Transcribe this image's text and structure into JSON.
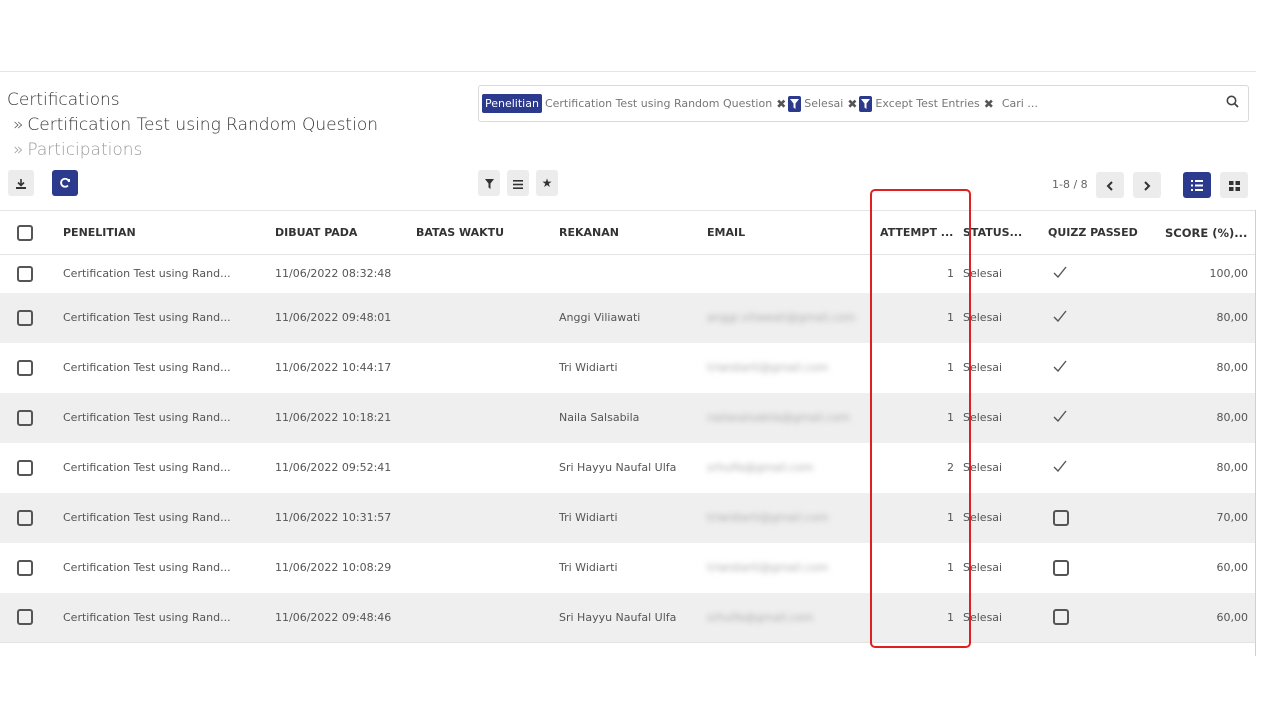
{
  "breadcrumb": {
    "item1": "Certifications",
    "sep": "»",
    "item2": "Certification Test using Random Question",
    "item3": "Participations"
  },
  "search": {
    "facet_tag": "Penelitian",
    "facet_value": "Certification Test using Random Question",
    "filter1": "Selesai",
    "filter2": "Except Test Entries",
    "placeholder": "Cari ...",
    "search_icon": "search-icon"
  },
  "toolbar": {
    "download_icon": "download-icon",
    "refresh_icon": "refresh-icon",
    "filter_icon": "filter-icon",
    "groupby_icon": "list-icon",
    "favorites_icon": "star-icon",
    "list_view_icon": "list-view-icon",
    "kanban_view_icon": "kanban-view-icon"
  },
  "pager": {
    "text": "1-8 / 8"
  },
  "colors": {
    "accent": "#2b3a8c",
    "highlight": "#e02020",
    "stripe": "#efefef"
  },
  "table": {
    "headers": {
      "penelitian": "PENELITIAN",
      "dibuat": "DIBUAT PADA",
      "batas": "BATAS WAKTU",
      "rekanan": "REKANAN",
      "email": "EMAIL",
      "attempt": "ATTEMPT ...",
      "status": "STATUS...",
      "passed": "QUIZZ PASSED",
      "score": "SCORE (%)..."
    },
    "rows": [
      {
        "penelitian": "Certification Test using Rand...",
        "dibuat": "11/06/2022 08:32:48",
        "batas": "",
        "rekanan": "",
        "email": "",
        "attempt": "1",
        "status": "Selesai",
        "passed": true,
        "score": "100,00"
      },
      {
        "penelitian": "Certification Test using Rand...",
        "dibuat": "11/06/2022 09:48:01",
        "batas": "",
        "rekanan": "Anggi Viliawati",
        "email": "anggi.viliawati@gmail.com",
        "attempt": "1",
        "status": "Selesai",
        "passed": true,
        "score": "80,00"
      },
      {
        "penelitian": "Certification Test using Rand...",
        "dibuat": "11/06/2022 10:44:17",
        "batas": "",
        "rekanan": "Tri Widiarti",
        "email": "triwidiarti@gmail.com",
        "attempt": "1",
        "status": "Selesai",
        "passed": true,
        "score": "80,00"
      },
      {
        "penelitian": "Certification Test using Rand...",
        "dibuat": "11/06/2022 10:18:21",
        "batas": "",
        "rekanan": "Naila Salsabila",
        "email": "nailasalsabila@gmail.com",
        "attempt": "1",
        "status": "Selesai",
        "passed": true,
        "score": "80,00"
      },
      {
        "penelitian": "Certification Test using Rand...",
        "dibuat": "11/06/2022 09:52:41",
        "batas": "",
        "rekanan": "Sri Hayyu Naufal Ulfa",
        "email": "srhulfa@gmail.com",
        "attempt": "2",
        "status": "Selesai",
        "passed": true,
        "score": "80,00"
      },
      {
        "penelitian": "Certification Test using Rand...",
        "dibuat": "11/06/2022 10:31:57",
        "batas": "",
        "rekanan": "Tri Widiarti",
        "email": "triwidiarti@gmail.com",
        "attempt": "1",
        "status": "Selesai",
        "passed": false,
        "score": "70,00"
      },
      {
        "penelitian": "Certification Test using Rand...",
        "dibuat": "11/06/2022 10:08:29",
        "batas": "",
        "rekanan": "Tri Widiarti",
        "email": "triwidiarti@gmail.com",
        "attempt": "1",
        "status": "Selesai",
        "passed": false,
        "score": "60,00"
      },
      {
        "penelitian": "Certification Test using Rand...",
        "dibuat": "11/06/2022 09:48:46",
        "batas": "",
        "rekanan": "Sri Hayyu Naufal Ulfa",
        "email": "srhulfa@gmail.com",
        "attempt": "1",
        "status": "Selesai",
        "passed": false,
        "score": "60,00"
      }
    ]
  }
}
